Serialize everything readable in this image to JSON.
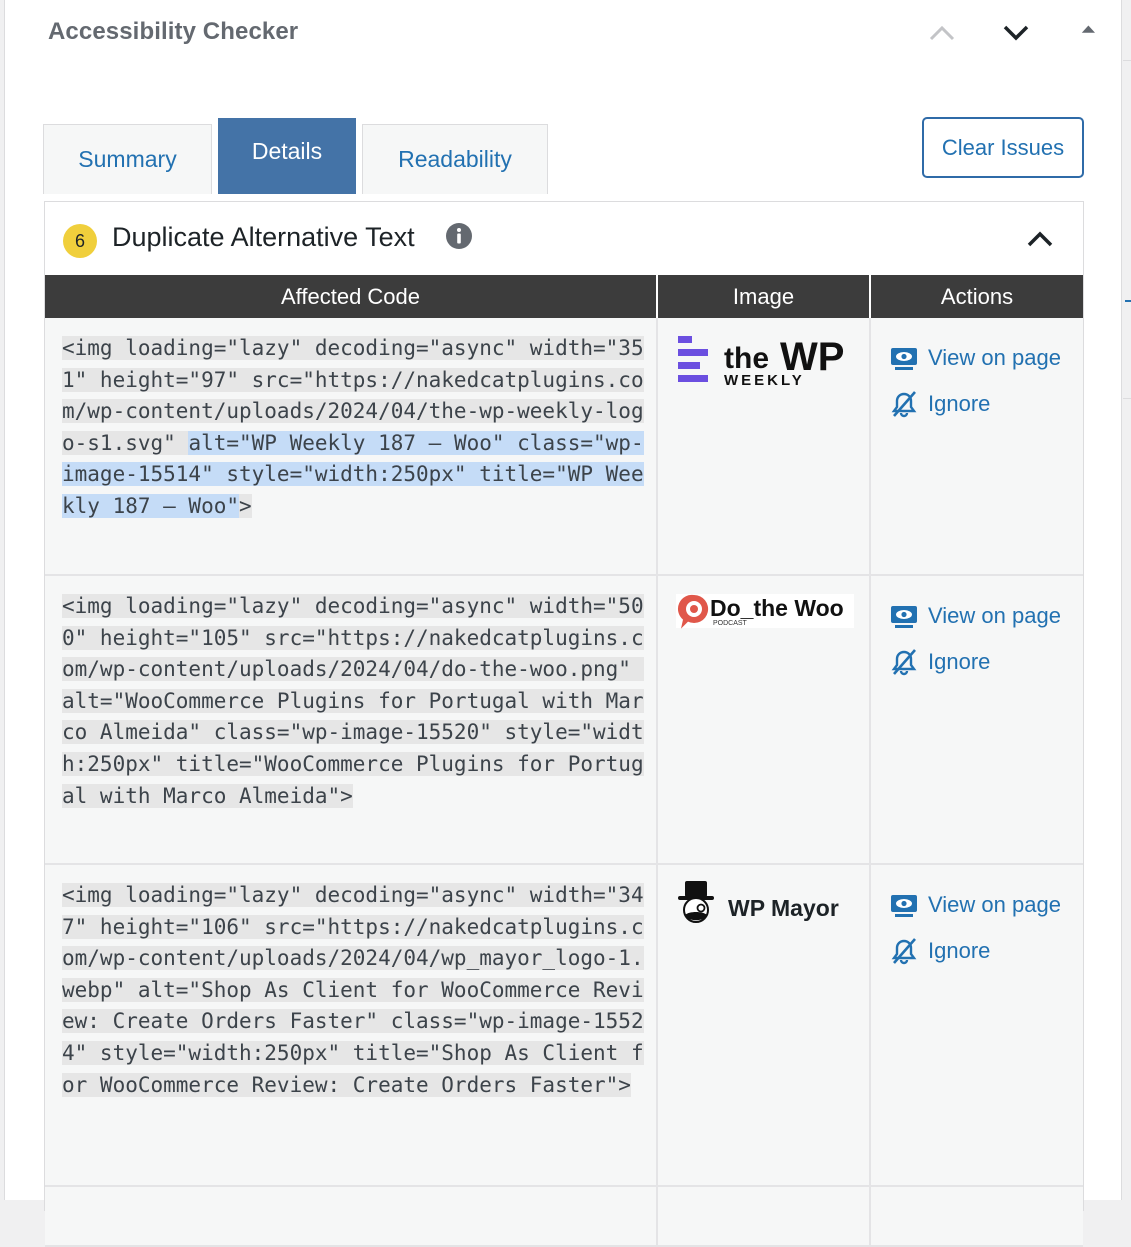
{
  "header": {
    "title": "Accessibility Checker",
    "move_up_icon": "chevron-up-icon",
    "move_down_icon": "chevron-down-icon",
    "toggle_icon": "triangle-up-icon"
  },
  "tabs": [
    {
      "label": "Summary",
      "active": false
    },
    {
      "label": "Details",
      "active": true
    },
    {
      "label": "Readability",
      "active": false
    }
  ],
  "clear_button": "Clear Issues",
  "issue": {
    "count": "6",
    "title": "Duplicate Alternative Text",
    "info_icon": "info-icon",
    "collapse_icon": "chevron-up-icon"
  },
  "table": {
    "headers": [
      "Affected Code",
      "Image",
      "Actions"
    ],
    "rows": [
      {
        "code": "<img loading=\"lazy\" decoding=\"async\" width=\"351\" height=\"97\" src=\"https://nakedcatplugins.com/wp-content/uploads/2024/04/the-wp-weekly-logo-s1.svg\" ",
        "code_highlight": "alt=\"WP Weekly 187 – Woo\" class=\"wp-image-15514\" style=\"width:250px\" title=\"WP Weekly 187 – Woo\"",
        "code_end": ">",
        "logo": {
          "line1": "the",
          "line2": "WP",
          "line3": "WEEKLY"
        },
        "view_label": "View on page",
        "ignore_label": "Ignore"
      },
      {
        "code": "<img loading=\"lazy\" decoding=\"async\" width=\"500\" height=\"105\" src=\"https://nakedcatplugins.com/wp-content/uploads/2024/04/do-the-woo.png\" alt=\"WooCommerce Plugins for Portugal with Marco Almeida\" class=\"wp-image-15520\" style=\"width:250px\" title=\"WooCommerce Plugins for Portugal with Marco Almeida\">",
        "logo": {
          "name": "Do_the Woo",
          "sub": "PODCAST"
        },
        "view_label": "View on page",
        "ignore_label": "Ignore"
      },
      {
        "code": "<img loading=\"lazy\" decoding=\"async\" width=\"347\" height=\"106\" src=\"https://nakedcatplugins.com/wp-content/uploads/2024/04/wp_mayor_logo-1.webp\" alt=\"Shop As Client for WooCommerce Review: Create Orders Faster\" class=\"wp-image-15524\" style=\"width:250px\" title=\"Shop As Client for WooCommerce Review: Create Orders Faster\">",
        "logo": {
          "name": "WP Mayor"
        },
        "view_label": "View on page",
        "ignore_label": "Ignore"
      }
    ]
  },
  "colors": {
    "accent": "#2271b1",
    "active_tab": "#4473a7",
    "table_header": "#3c3c3c",
    "badge": "#f0cf3c",
    "selection": "#c5dcf7"
  }
}
